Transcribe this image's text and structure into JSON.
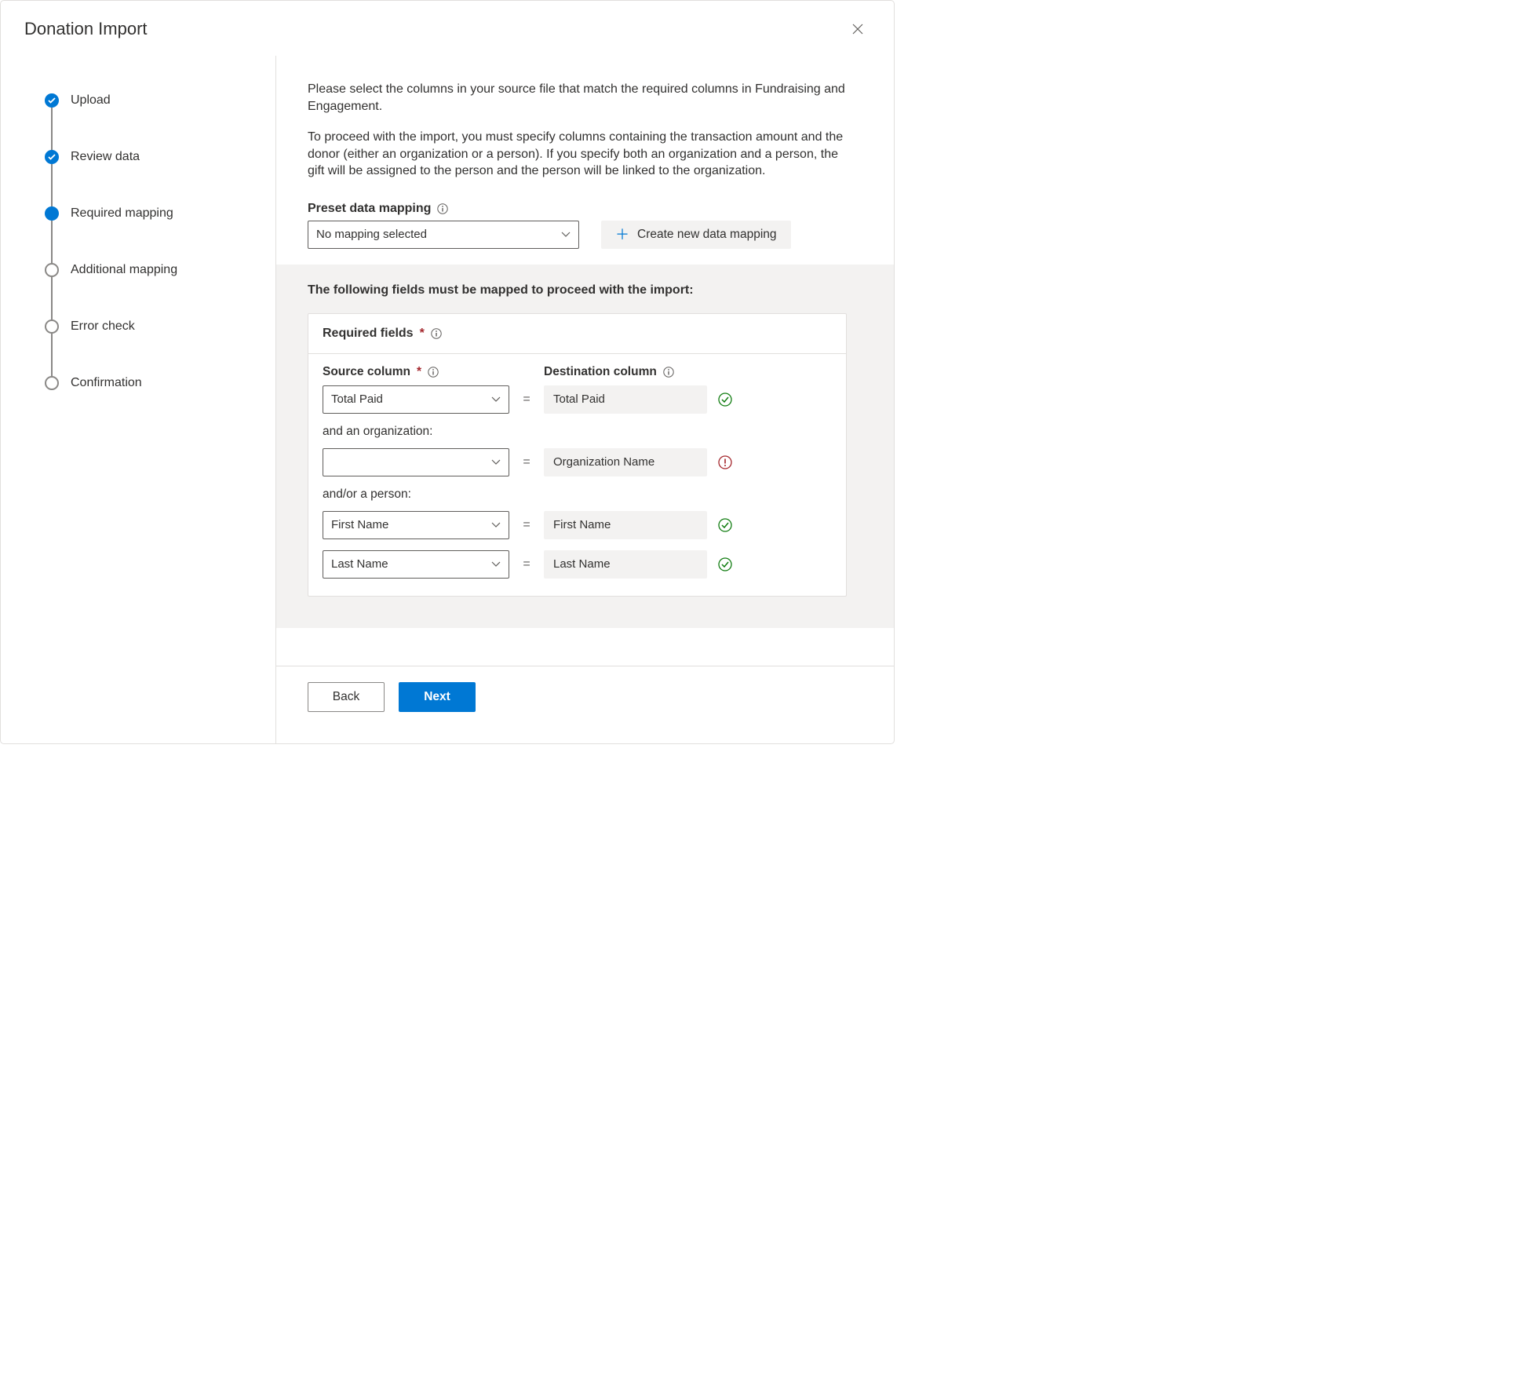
{
  "header": {
    "title": "Donation Import"
  },
  "steps": [
    {
      "label": "Upload",
      "state": "done"
    },
    {
      "label": "Review data",
      "state": "done"
    },
    {
      "label": "Required mapping",
      "state": "current"
    },
    {
      "label": "Additional mapping",
      "state": "pending"
    },
    {
      "label": "Error check",
      "state": "pending"
    },
    {
      "label": "Confirmation",
      "state": "pending"
    }
  ],
  "intro": {
    "p1": "Please select the columns in your source file that match the required columns in Fundraising and Engagement.",
    "p2": "To proceed with the import, you must specify columns containing the transaction amount and the donor (either an organization or a person). If you specify both an organization and a person, the gift will be assigned to the person and the person will be linked to the organization."
  },
  "preset": {
    "label": "Preset data mapping",
    "value": "No mapping selected",
    "create_label": "Create new data mapping"
  },
  "mapping": {
    "heading": "The following fields must be mapped to proceed with the import:",
    "card_title": "Required fields",
    "source_header": "Source column",
    "dest_header": "Destination column",
    "and_org": "and an organization:",
    "andor_person": "and/or a person:",
    "rows": {
      "total_paid": {
        "source": "Total Paid",
        "dest": "Total Paid",
        "status": "ok"
      },
      "org": {
        "source": "",
        "dest": "Organization Name",
        "status": "error"
      },
      "first": {
        "source": "First Name",
        "dest": "First Name",
        "status": "ok"
      },
      "last": {
        "source": "Last Name",
        "dest": "Last Name",
        "status": "ok"
      }
    }
  },
  "footer": {
    "back": "Back",
    "next": "Next"
  }
}
